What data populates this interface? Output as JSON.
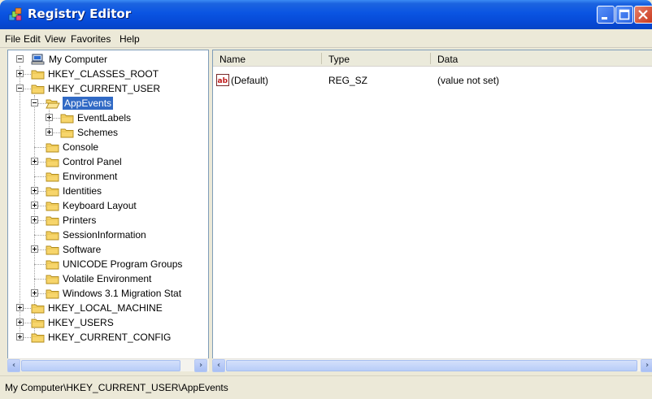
{
  "window": {
    "title": "Registry Editor",
    "icon": "registry-editor-icon"
  },
  "menu": [
    "File",
    "Edit",
    "View",
    "Favorites",
    "Help"
  ],
  "tree": {
    "root": "My Computer",
    "items": [
      {
        "label": "HKEY_CLASSES_ROOT"
      },
      {
        "label": "HKEY_CURRENT_USER"
      },
      {
        "label": "AppEvents"
      },
      {
        "label": "EventLabels"
      },
      {
        "label": "Schemes"
      },
      {
        "label": "Console"
      },
      {
        "label": "Control Panel"
      },
      {
        "label": "Environment"
      },
      {
        "label": "Identities"
      },
      {
        "label": "Keyboard Layout"
      },
      {
        "label": "Printers"
      },
      {
        "label": "SessionInformation"
      },
      {
        "label": "Software"
      },
      {
        "label": "UNICODE Program Groups"
      },
      {
        "label": "Volatile Environment"
      },
      {
        "label": "Windows 3.1 Migration Stat"
      },
      {
        "label": "HKEY_LOCAL_MACHINE"
      },
      {
        "label": "HKEY_USERS"
      },
      {
        "label": "HKEY_CURRENT_CONFIG"
      }
    ]
  },
  "list": {
    "columns": [
      "Name",
      "Type",
      "Data"
    ],
    "rows": [
      {
        "name": "(Default)",
        "type": "REG_SZ",
        "data": "(value not set)",
        "icon": "string-value-icon"
      }
    ]
  },
  "status": "My Computer\\HKEY_CURRENT_USER\\AppEvents",
  "colors": {
    "titlebar": "#0a54e2",
    "selection": "#316ac5",
    "folder": "#f7d56b"
  }
}
